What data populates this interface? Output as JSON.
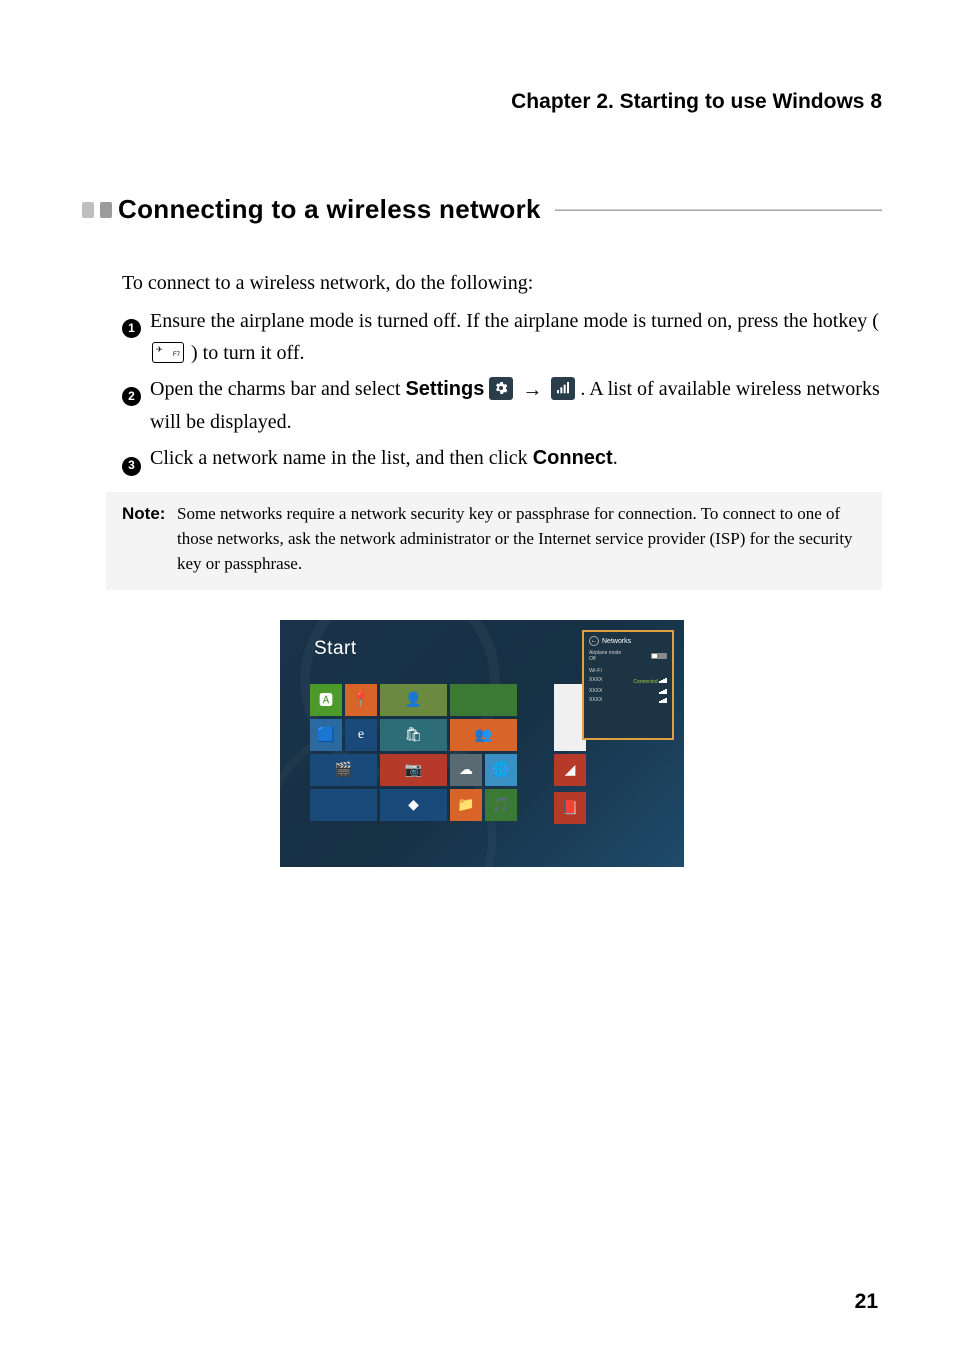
{
  "chapter_header": "Chapter 2. Starting to use Windows 8",
  "section_title": "Connecting to a wireless network",
  "intro": "To connect to a wireless network, do the following:",
  "hotkey_fn": "F7",
  "steps": {
    "s1": {
      "num": "1",
      "text_a": "Ensure the airplane mode is turned off. If the airplane mode is turned on, press the hotkey (",
      "text_b": ") to turn it off."
    },
    "s2": {
      "num": "2",
      "text_a": "Open the charms bar and select ",
      "settings_label": "Settings",
      "text_b": " . A list of available wireless networks will be displayed."
    },
    "s3": {
      "num": "3",
      "text_a": "Click a network name in the list, and then click ",
      "connect_label": "Connect",
      "text_b": "."
    }
  },
  "note": {
    "label": "Note:",
    "body": "Some networks require a network security key or passphrase for connection. To connect to one of those networks, ask the network administrator or the Internet service provider (ISP) for the security key or passphrase."
  },
  "screenshot": {
    "start": "Start",
    "networks_title": "Networks",
    "airplane_label": "Airplane mode",
    "airplane_value": "Off",
    "wifi_label": "Wi-Fi",
    "items": [
      {
        "name": "XXXX",
        "status": "Connected"
      },
      {
        "name": "XXXX",
        "status": ""
      },
      {
        "name": "XXXX",
        "status": ""
      }
    ]
  },
  "page_number": "21",
  "arrow": "→"
}
